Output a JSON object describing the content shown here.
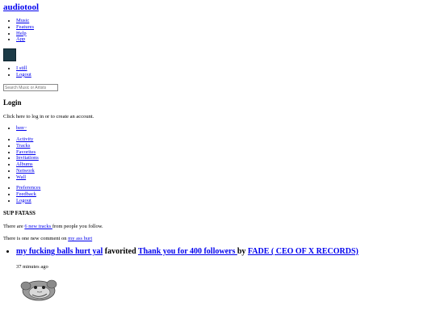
{
  "header": {
    "logo": "audiotool"
  },
  "main_nav": {
    "items": [
      "Music",
      "Features",
      "Help",
      "App"
    ]
  },
  "user_menu": {
    "items": [
      "I still",
      "Logout"
    ]
  },
  "search": {
    "placeholder": "Search Music or Artists"
  },
  "login": {
    "heading": "Login",
    "text": "Click here to log in or to create an account."
  },
  "account": {
    "name": "ben~"
  },
  "profile_nav": {
    "items": [
      "Activity",
      "Tracks",
      "Favorites",
      "Invitations",
      "Albums",
      "Network",
      "Wall"
    ]
  },
  "settings_nav": {
    "items": [
      "Preferences",
      "Feedback",
      "Logout"
    ]
  },
  "feed": {
    "title": "SUP FATASS",
    "tracks_prefix": "There are ",
    "tracks_link": "6 new tracks ",
    "tracks_suffix": "from people you follow.",
    "comment_prefix": "There is one new comment on ",
    "comment_link": "my ass hurt"
  },
  "activity": {
    "actor": "my fucking balls hurt yal",
    "verb": " favorited ",
    "track": "Thank you for 400 followers ",
    "by": "by ",
    "artist": "FADE ( CEO OF X RECORDS)",
    "time": "37 minutes ago"
  },
  "icons": {
    "track_art": "monkey-face-cover-art",
    "avatar": "user-avatar"
  },
  "colors": {
    "link": "#0000ee",
    "avatar_bg": "#1c3b47"
  }
}
